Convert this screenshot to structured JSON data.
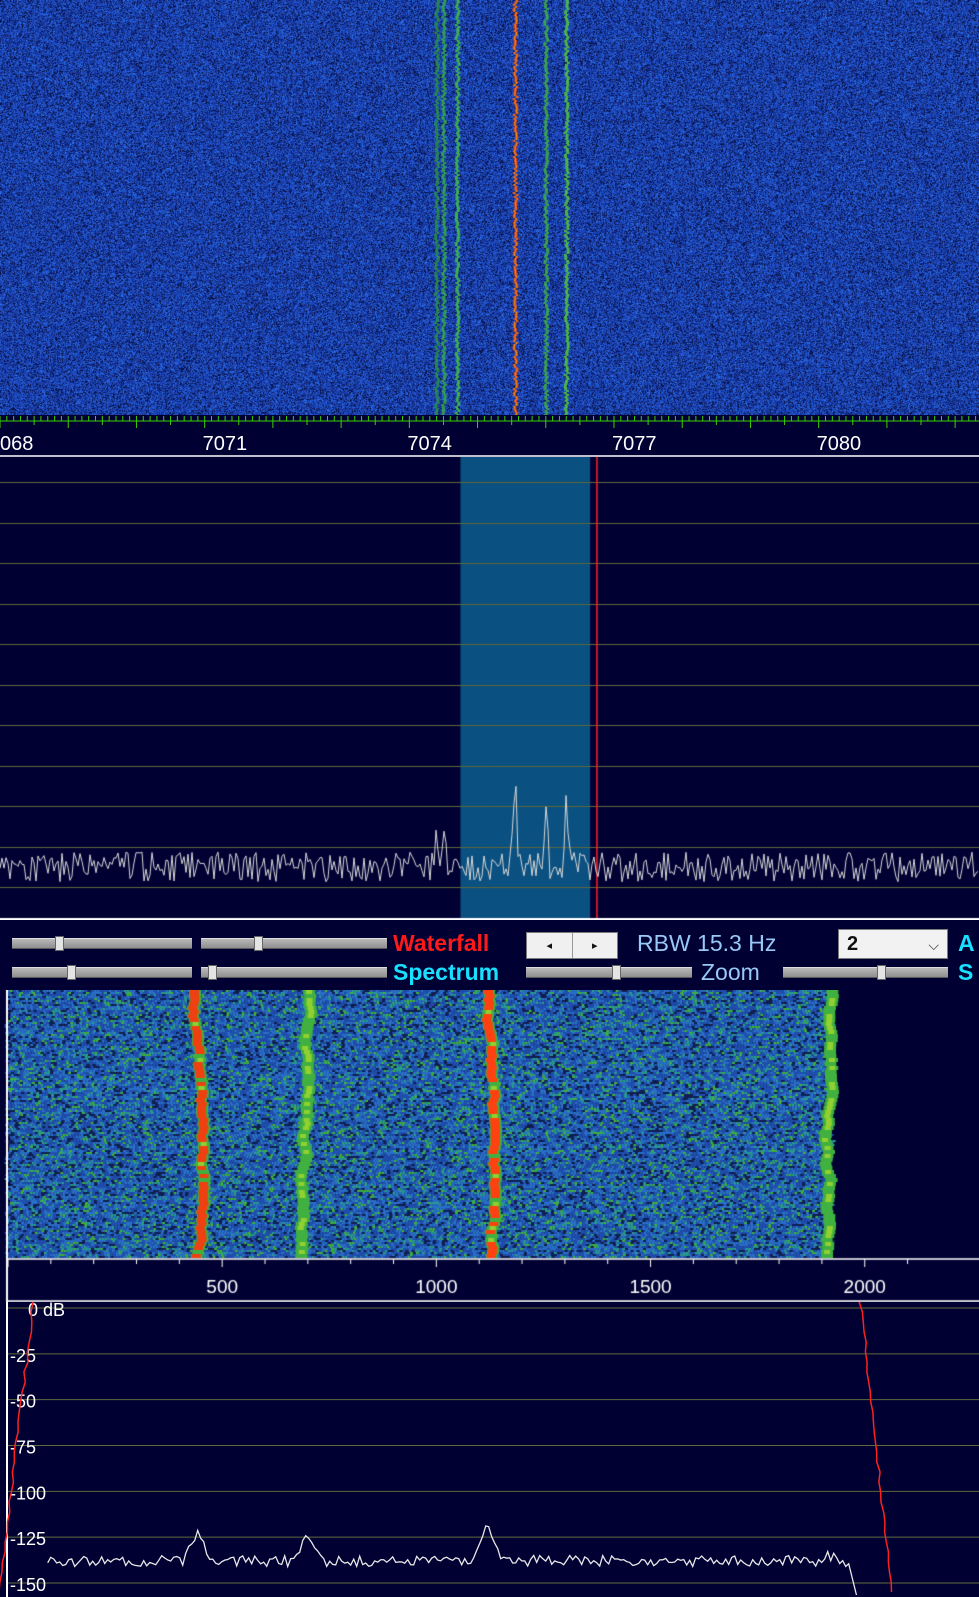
{
  "main_waterfall": {
    "signals": [
      {
        "freq": 7074.4,
        "strength": 0.55,
        "color": "#2f9a3a"
      },
      {
        "freq": 7074.5,
        "strength": 0.7,
        "color": "#3ab040"
      },
      {
        "freq": 7074.7,
        "strength": 0.75,
        "color": "#44c044"
      },
      {
        "freq": 7075.55,
        "strength": 1.0,
        "color": "#e04010"
      },
      {
        "freq": 7076.0,
        "strength": 0.75,
        "color": "#40b040"
      },
      {
        "freq": 7076.3,
        "strength": 0.85,
        "color": "#50c040"
      }
    ]
  },
  "frequency_ruler": {
    "start": 7068.0,
    "end": 7082.35,
    "labels": [
      "068",
      "7071",
      "7074",
      "7077",
      "7080"
    ],
    "label_values": [
      7068,
      7071,
      7074,
      7077,
      7080
    ]
  },
  "main_spectrum": {
    "passband": {
      "low": 7074.75,
      "high": 7076.65
    },
    "tuning_freq": 7076.75,
    "peaks": [
      {
        "freq": 7074.4,
        "level": 0.45
      },
      {
        "freq": 7074.5,
        "level": 0.4
      },
      {
        "freq": 7075.55,
        "level": 0.95
      },
      {
        "freq": 7076.0,
        "level": 0.6
      },
      {
        "freq": 7076.3,
        "level": 0.65
      }
    ]
  },
  "controls": {
    "waterfall_label": "Waterfall",
    "spectrum_label": "Spectrum",
    "rbw_label": "RBW 15.3 Hz",
    "zoom_label": "Zoom",
    "averaging_select": "2",
    "right_label_1": "A",
    "right_label_2": "S",
    "prev_icon": "◂",
    "next_icon": "▸",
    "chevron": "⌵",
    "sliders": {
      "waterfall_1": 0.25,
      "waterfall_2": 0.3,
      "spectrum_1": 0.32,
      "spectrum_2": 0.04,
      "zoom": 0.55,
      "speed": 0.6
    }
  },
  "audio_waterfall": {
    "freq_start": 0,
    "freq_end": 2130,
    "active_range": [
      80,
      1990
    ],
    "signals": [
      {
        "freq": 440,
        "strength": 0.95,
        "color": "#ee4010"
      },
      {
        "freq": 700,
        "strength": 0.8,
        "color": "#55cc30"
      },
      {
        "freq": 1120,
        "strength": 1.0,
        "color": "#ff4010"
      },
      {
        "freq": 1920,
        "strength": 0.7,
        "color": "#55cc30"
      }
    ]
  },
  "audio_ruler": {
    "labels": [
      "500",
      "1000",
      "1500",
      "2000"
    ],
    "label_values": [
      500,
      1000,
      1500,
      2000
    ]
  },
  "audio_spectrum": {
    "db_labels": [
      "0 dB",
      "-25",
      "-50",
      "-75",
      "-100",
      "-125",
      "-150"
    ],
    "db_values": [
      0,
      -25,
      -50,
      -75,
      -100,
      -125,
      -150
    ],
    "filter_edges": [
      60,
      1990
    ],
    "peaks": [
      {
        "freq": 440,
        "db": -122
      },
      {
        "freq": 700,
        "db": -124
      },
      {
        "freq": 1120,
        "db": -118
      },
      {
        "freq": 1920,
        "db": -135
      }
    ]
  },
  "colors": {
    "background": "#000033",
    "waterfall_base": "#1a3a9a",
    "grid": "#5f6a3a",
    "trace": "#d8d8d8",
    "passband": "#0a5080",
    "tuning_marker": "#ff2020",
    "ruler_ticks": "#3ad000",
    "filter_curve": "#ff2020"
  }
}
